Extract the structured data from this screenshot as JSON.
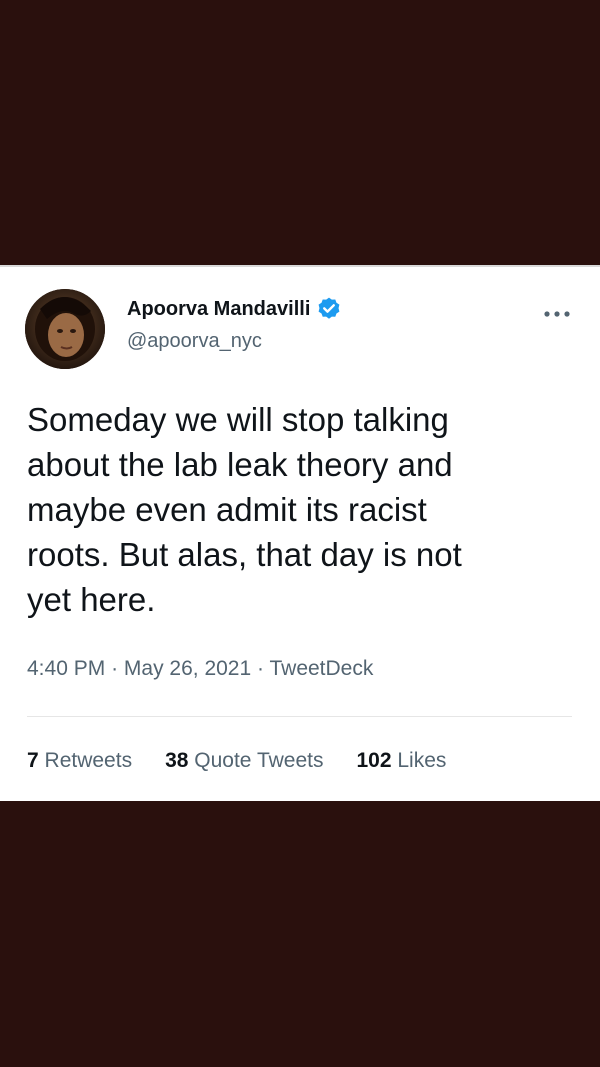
{
  "tweet": {
    "display_name": "Apoorva Mandavilli",
    "handle": "@apoorva_nyc",
    "text": "Someday we will stop talking\nabout the lab leak theory and\nmaybe even admit its racist\nroots. But alas, that day is not\nyet here.",
    "time": "4:40 PM",
    "separator": "·",
    "date": "May 26, 2021",
    "source": "TweetDeck",
    "stats": {
      "retweets_count": "7",
      "retweets_label": "Retweets",
      "quote_count": "38",
      "quote_label": "Quote Tweets",
      "likes_count": "102",
      "likes_label": "Likes"
    }
  },
  "icons": {
    "verified": "verified-badge-icon",
    "more": "more-options-icon"
  },
  "colors": {
    "background": "#2a100d",
    "card": "#ffffff",
    "text_primary": "#0f1419",
    "text_secondary": "#536471",
    "verified_blue": "#1d9bf0"
  }
}
